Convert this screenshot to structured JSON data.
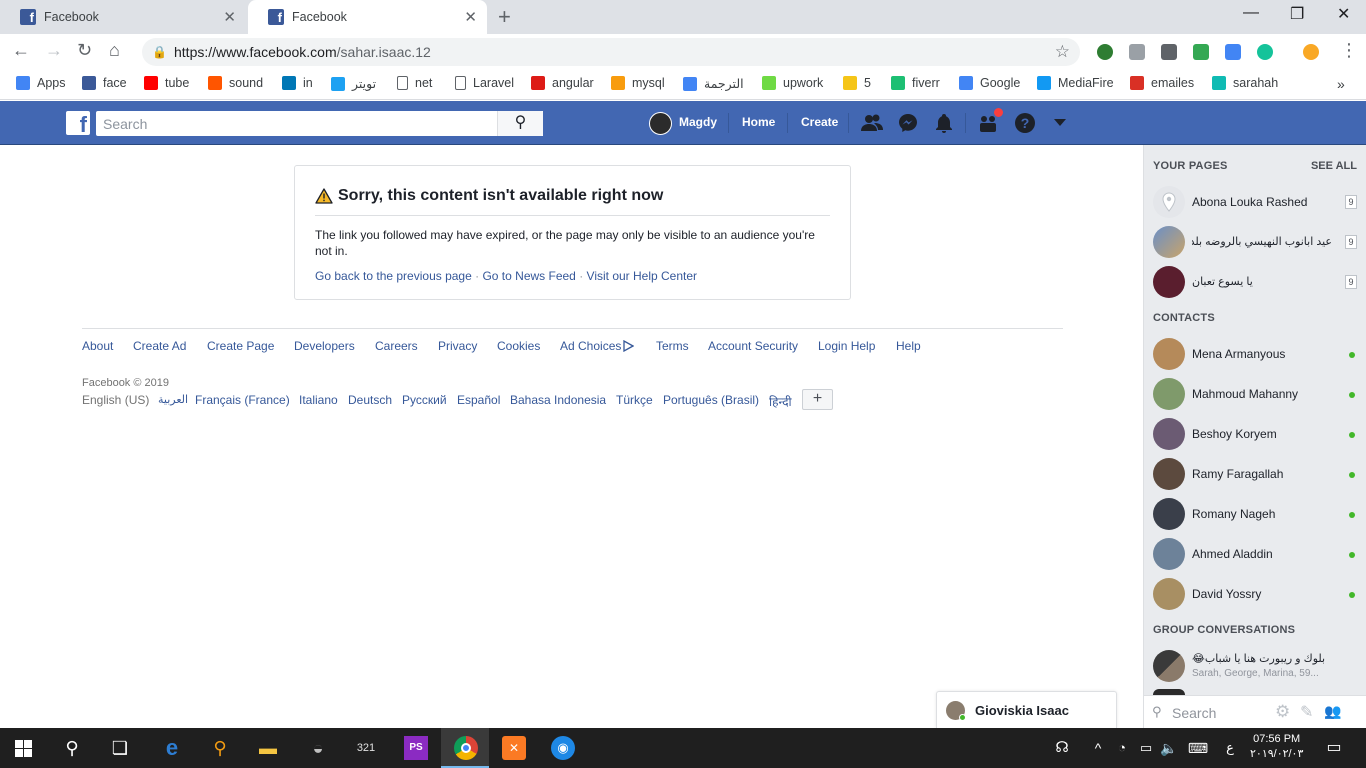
{
  "browser": {
    "tabs": [
      {
        "title": "Facebook",
        "active": false
      },
      {
        "title": "Facebook",
        "active": true
      }
    ],
    "url_host": "https://www.facebook.com",
    "url_path": "/sahar.isaac.12",
    "bookmarks": [
      {
        "label": "Apps",
        "icon": "apps-grid-icon",
        "color": "#4285f4"
      },
      {
        "label": "face",
        "icon": "facebook-icon",
        "color": "#3b5998"
      },
      {
        "label": "tube",
        "icon": "youtube-icon",
        "color": "#ff0000"
      },
      {
        "label": "sound",
        "icon": "soundcloud-icon",
        "color": "#ff5500"
      },
      {
        "label": "in",
        "icon": "linkedin-icon",
        "color": "#0077b5"
      },
      {
        "label": "تويتر",
        "icon": "twitter-icon",
        "color": "#1da1f2"
      },
      {
        "label": "net",
        "icon": "page-icon",
        "color": "#ffffff"
      },
      {
        "label": "Laravel",
        "icon": "page-icon",
        "color": "#ffffff"
      },
      {
        "label": "angular",
        "icon": "angular-icon",
        "color": "#dd1b16"
      },
      {
        "label": "mysql",
        "icon": "phpmyadmin-icon",
        "color": "#f89c0e"
      },
      {
        "label": "الترجمة",
        "icon": "translate-icon",
        "color": "#4285f4"
      },
      {
        "label": "upwork",
        "icon": "upwork-icon",
        "color": "#6fda44"
      },
      {
        "label": "5",
        "icon": "five-icon",
        "color": "#f5c518"
      },
      {
        "label": "fiverr",
        "icon": "fiverr-icon",
        "color": "#1dbf73"
      },
      {
        "label": "Google",
        "icon": "google-icon",
        "color": "#4285f4"
      },
      {
        "label": "MediaFire",
        "icon": "mediafire-icon",
        "color": "#1299f3"
      },
      {
        "label": "emailes",
        "icon": "gmail-icon",
        "color": "#d93025"
      },
      {
        "label": "sarahah",
        "icon": "sarahah-icon",
        "color": "#10bbb3"
      }
    ]
  },
  "fb": {
    "search_placeholder": "Search",
    "profile_name": "Magdy",
    "nav_home": "Home",
    "nav_create": "Create"
  },
  "error": {
    "title": "Sorry, this content isn't available right now",
    "body": "The link you followed may have expired, or the page may only be visible to an audience you're not in.",
    "links": [
      "Go back to the previous page",
      "Go to News Feed",
      "Visit our Help Center"
    ],
    "separator": "·"
  },
  "footer": {
    "links": [
      "About",
      "Create Ad",
      "Create Page",
      "Developers",
      "Careers",
      "Privacy",
      "Cookies",
      "Ad Choices",
      "Terms",
      "Account Security",
      "Login Help",
      "Help"
    ],
    "copyright": "Facebook © 2019",
    "languages": [
      "English (US)",
      "العربية",
      "Français (France)",
      "Italiano",
      "Deutsch",
      "Русский",
      "Español",
      "Bahasa Indonesia",
      "Türkçe",
      "Português (Brasil)",
      "हिन्दी"
    ],
    "lang_more": "+"
  },
  "sidebar": {
    "your_pages_heading": "YOUR PAGES",
    "see_all": "SEE ALL",
    "pages": [
      {
        "name": "Abona Louka Rashed",
        "count": "9"
      },
      {
        "name": "عيد ابانوب النهيسي بالروضه بلد .",
        "count": "9"
      },
      {
        "name": "يا يسوع تعبان",
        "count": "9"
      }
    ],
    "contacts_heading": "CONTACTS",
    "contacts": [
      {
        "name": "Mena Armanyous"
      },
      {
        "name": "Mahmoud Mahanny"
      },
      {
        "name": "Beshoy Koryem"
      },
      {
        "name": "Ramy Faragallah"
      },
      {
        "name": "Romany Nageh"
      },
      {
        "name": "Ahmed Aladdin"
      },
      {
        "name": "David Yossry"
      }
    ],
    "group_heading": "GROUP CONVERSATIONS",
    "group": {
      "name": "😂بلوك و ريبورت هنا يا شباب",
      "members": "Sarah, George, Marina, 59..."
    },
    "search_placeholder": "Search"
  },
  "chat_tab": {
    "name": "Gioviskia Isaac"
  },
  "taskbar": {
    "time": "07:56 PM",
    "date": "٢٠١٩/٠٢/٠٣",
    "lang": "ع"
  }
}
